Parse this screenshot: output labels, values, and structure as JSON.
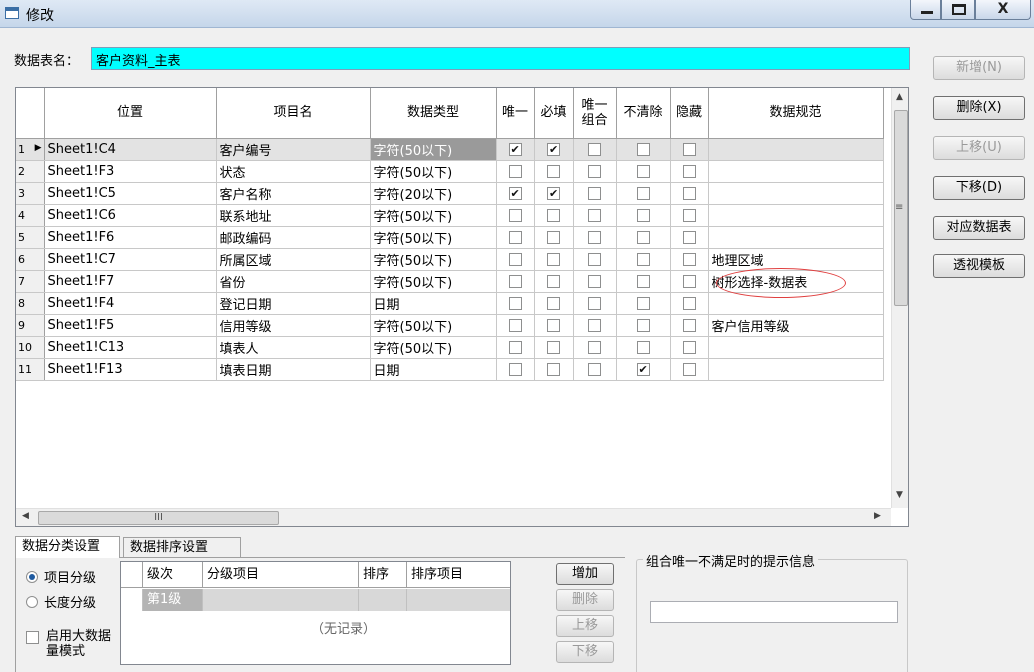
{
  "window": {
    "title": "修改",
    "minimize_label": "",
    "maximize_label": "",
    "close_label": "X"
  },
  "table_name": {
    "label": "数据表名：",
    "value": "客户资料_主表",
    "highlight_color": "#00ffff"
  },
  "side_buttons": {
    "add": "新增(N)",
    "delete": "删除(X)",
    "move_up": "上移(U)",
    "move_down": "下移(D)",
    "map_table": "对应数据表",
    "pivot_template": "透视模板"
  },
  "grid": {
    "columns": [
      "位置",
      "项目名",
      "数据类型",
      "唯一",
      "必填",
      "唯一组合",
      "不清除",
      "隐藏",
      "数据规范"
    ],
    "col3_line1": "唯一",
    "col3_line2": "组合",
    "rows": [
      {
        "num": "1",
        "pos": "Sheet1!C4",
        "name": "客户编号",
        "type": "字符(50以下)",
        "unique": true,
        "required": true,
        "combo": false,
        "keep": false,
        "hidden": false,
        "spec": ""
      },
      {
        "num": "2",
        "pos": "Sheet1!F3",
        "name": "状态",
        "type": "字符(50以下)",
        "unique": false,
        "required": false,
        "combo": false,
        "keep": false,
        "hidden": false,
        "spec": ""
      },
      {
        "num": "3",
        "pos": "Sheet1!C5",
        "name": "客户名称",
        "type": "字符(20以下)",
        "unique": true,
        "required": true,
        "combo": false,
        "keep": false,
        "hidden": false,
        "spec": ""
      },
      {
        "num": "4",
        "pos": "Sheet1!C6",
        "name": "联系地址",
        "type": "字符(50以下)",
        "unique": false,
        "required": false,
        "combo": false,
        "keep": false,
        "hidden": false,
        "spec": ""
      },
      {
        "num": "5",
        "pos": "Sheet1!F6",
        "name": "邮政编码",
        "type": "字符(50以下)",
        "unique": false,
        "required": false,
        "combo": false,
        "keep": false,
        "hidden": false,
        "spec": ""
      },
      {
        "num": "6",
        "pos": "Sheet1!C7",
        "name": "所属区域",
        "type": "字符(50以下)",
        "unique": false,
        "required": false,
        "combo": false,
        "keep": false,
        "hidden": false,
        "spec": "地理区域"
      },
      {
        "num": "7",
        "pos": "Sheet1!F7",
        "name": "省份",
        "type": "字符(50以下)",
        "unique": false,
        "required": false,
        "combo": false,
        "keep": false,
        "hidden": false,
        "spec": "树形选择-数据表"
      },
      {
        "num": "8",
        "pos": "Sheet1!F4",
        "name": "登记日期",
        "type": "日期",
        "unique": false,
        "required": false,
        "combo": false,
        "keep": false,
        "hidden": false,
        "spec": ""
      },
      {
        "num": "9",
        "pos": "Sheet1!F5",
        "name": "信用等级",
        "type": "字符(50以下)",
        "unique": false,
        "required": false,
        "combo": false,
        "keep": false,
        "hidden": false,
        "spec": "客户信用等级"
      },
      {
        "num": "10",
        "pos": "Sheet1!C13",
        "name": "填表人",
        "type": "字符(50以下)",
        "unique": false,
        "required": false,
        "combo": false,
        "keep": false,
        "hidden": false,
        "spec": ""
      },
      {
        "num": "11",
        "pos": "Sheet1!F13",
        "name": "填表日期",
        "type": "日期",
        "unique": false,
        "required": false,
        "combo": false,
        "keep": true,
        "hidden": false,
        "spec": ""
      }
    ],
    "selected_row": 1,
    "hscroll_grip": "III",
    "vscroll_grip": "≡"
  },
  "tabs": {
    "classify": "数据分类设置",
    "sort": "数据排序设置"
  },
  "classify": {
    "radio_item": "项目分级",
    "radio_length": "长度分级",
    "big_data": "启用大数据量模式",
    "columns": [
      "级次",
      "分级项目",
      "排序",
      "排序项目"
    ],
    "row1_level": "第1级",
    "no_record": "（无记录）",
    "btn_add": "增加",
    "btn_delete": "删除",
    "btn_up": "上移",
    "btn_down": "下移"
  },
  "combo_msg": {
    "legend": "组合唯一不满足时的提示信息",
    "value": ""
  }
}
